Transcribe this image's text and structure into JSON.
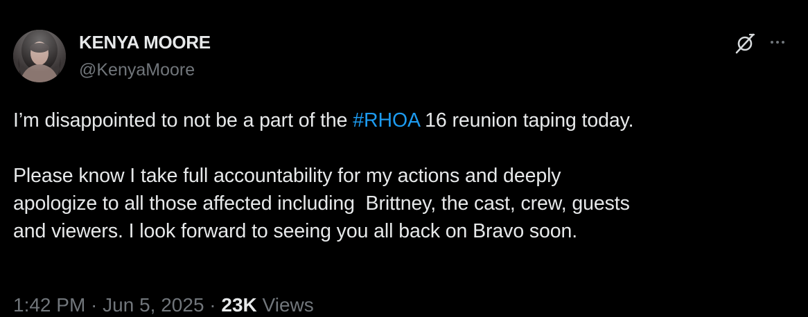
{
  "author": {
    "display_name": "KENYA MOORE",
    "handle": "@KenyaMoore",
    "avatar_icon": "profile-photo"
  },
  "header_actions": {
    "grok_icon": "grok-icon",
    "more_icon": "more-options-icon"
  },
  "tweet": {
    "p1_before": "I’m disappointed to not be a part of the ",
    "p1_hashtag": "#RHOA",
    "p1_after": " 16 reunion taping today.",
    "p2_line1": "Please know I take full accountability for my actions and deeply",
    "p2_line2": "apologize to all those affected including  Brittney, the cast, crew, guests",
    "p2_line3": "and viewers. I look forward to seeing you all back on Bravo soon."
  },
  "meta": {
    "time": "1:42 PM",
    "separator": " · ",
    "date": "Jun 5, 2025",
    "views_count": "23K",
    "views_label": " Views"
  },
  "colors": {
    "background": "#000000",
    "text_primary": "#e7e9ea",
    "text_secondary": "#71767b",
    "link": "#1d9bf0"
  }
}
